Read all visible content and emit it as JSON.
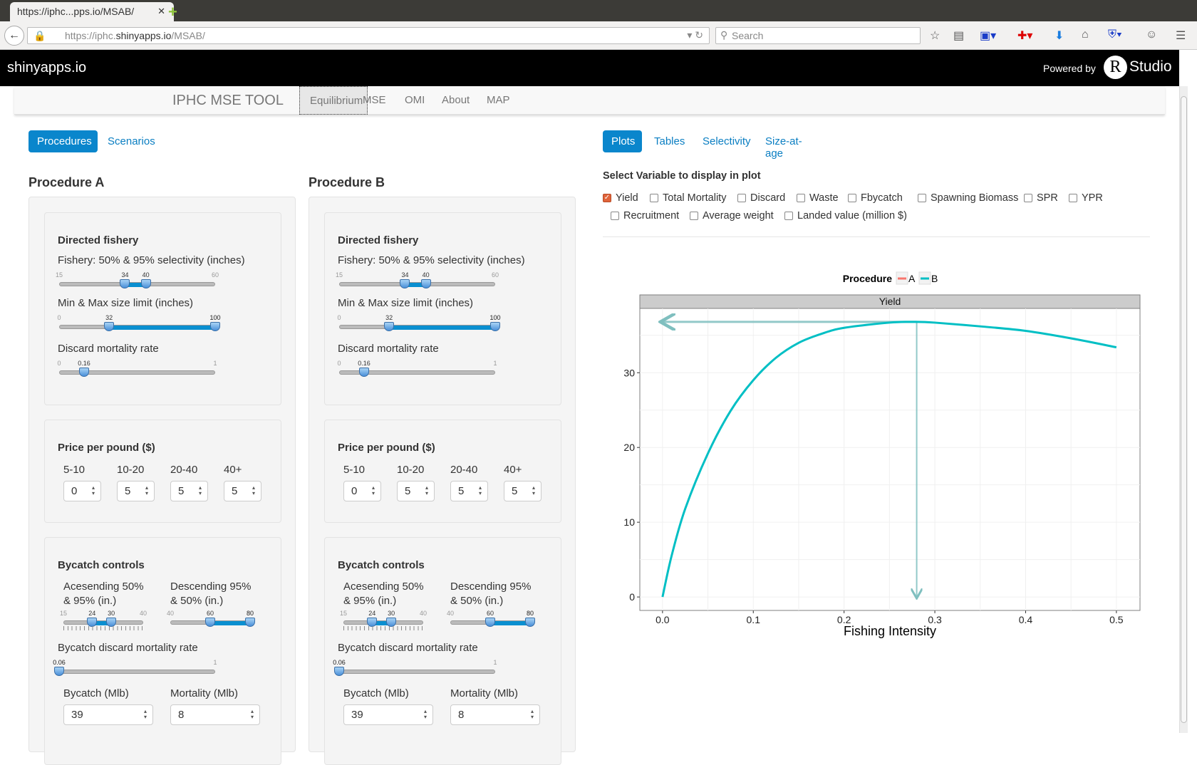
{
  "browser": {
    "tab_title": "https://iphc...pps.io/MSAB/",
    "url_prefix": "https://iphc.",
    "url_domain": "shinyapps.io",
    "url_path": "/MSAB/",
    "search_placeholder": "Search"
  },
  "header": {
    "brand": "shinyapps.io",
    "powered_by": "Powered by",
    "logo_r": "R",
    "logo_studio": "Studio"
  },
  "appnav": {
    "title": "IPHC MSE TOOL",
    "tabs": [
      "Equilibrium",
      "MSE",
      "OMI",
      "About",
      "MAP"
    ],
    "active": "Equilibrium"
  },
  "left_pills": {
    "items": [
      "Procedures",
      "Scenarios"
    ],
    "active": "Procedures"
  },
  "procedures": [
    {
      "title": "Procedure A",
      "directed": {
        "heading": "Directed fishery",
        "selectivity": {
          "label": "Fishery: 50% & 95% selectivity (inches)",
          "min": "15",
          "max": "60",
          "values": [
            34,
            40
          ]
        },
        "size_limit": {
          "label": "Min & Max size limit (inches)",
          "min": "0",
          "max": "100",
          "values": [
            32,
            100
          ]
        },
        "discard": {
          "label": "Discard mortality rate",
          "min": "0",
          "max": "1",
          "values": [
            0.16
          ]
        }
      },
      "price": {
        "heading": "Price per pound ($)",
        "bins": [
          {
            "label": "5-10",
            "value": "0"
          },
          {
            "label": "10-20",
            "value": "5"
          },
          {
            "label": "20-40",
            "value": "5"
          },
          {
            "label": "40+",
            "value": "5"
          }
        ]
      },
      "bycatch": {
        "heading": "Bycatch controls",
        "ascending": {
          "label1": "Acesending 50%",
          "label2": "& 95% (in.)",
          "min": "15",
          "max": "40",
          "values": [
            24,
            30
          ]
        },
        "descending": {
          "label1": "Descending 95%",
          "label2": "& 50% (in.)",
          "min": "40",
          "max": "80",
          "values": [
            60,
            80
          ]
        },
        "discard": {
          "label": "Bycatch discard mortality rate",
          "min": "0.06",
          "max": "1",
          "values": [
            0.06
          ]
        },
        "bycatch_mlb": {
          "label": "Bycatch (Mlb)",
          "value": "39"
        },
        "mortality_mlb": {
          "label": "Mortality (Mlb)",
          "value": "8"
        }
      }
    },
    {
      "title": "Procedure B",
      "directed": {
        "heading": "Directed fishery",
        "selectivity": {
          "label": "Fishery: 50% & 95% selectivity (inches)",
          "min": "15",
          "max": "60",
          "values": [
            34,
            40
          ]
        },
        "size_limit": {
          "label": "Min & Max size limit (inches)",
          "min": "0",
          "max": "100",
          "values": [
            32,
            100
          ]
        },
        "discard": {
          "label": "Discard mortality rate",
          "min": "0",
          "max": "1",
          "values": [
            0.16
          ]
        }
      },
      "price": {
        "heading": "Price per pound ($)",
        "bins": [
          {
            "label": "5-10",
            "value": "0"
          },
          {
            "label": "10-20",
            "value": "5"
          },
          {
            "label": "20-40",
            "value": "5"
          },
          {
            "label": "40+",
            "value": "5"
          }
        ]
      },
      "bycatch": {
        "heading": "Bycatch controls",
        "ascending": {
          "label1": "Acesending 50%",
          "label2": "& 95% (in.)",
          "min": "15",
          "max": "40",
          "values": [
            24,
            30
          ]
        },
        "descending": {
          "label1": "Descending 95%",
          "label2": "& 50% (in.)",
          "min": "40",
          "max": "80",
          "values": [
            60,
            80
          ]
        },
        "discard": {
          "label": "Bycatch discard mortality rate",
          "min": "0.06",
          "max": "1",
          "values": [
            0.06
          ]
        },
        "bycatch_mlb": {
          "label": "Bycatch (Mlb)",
          "value": "39"
        },
        "mortality_mlb": {
          "label": "Mortality (Mlb)",
          "value": "8"
        }
      }
    }
  ],
  "right_pills": {
    "items": [
      "Plots",
      "Tables",
      "Selectivity",
      "Size-at-age"
    ],
    "active": "Plots"
  },
  "variables": {
    "heading": "Select Variable to display in plot",
    "options": [
      {
        "label": "Yield",
        "checked": true
      },
      {
        "label": "Total Mortality",
        "checked": false
      },
      {
        "label": "Discard",
        "checked": false
      },
      {
        "label": "Waste",
        "checked": false
      },
      {
        "label": "Fbycatch",
        "checked": false
      },
      {
        "label": "Spawning Biomass",
        "checked": false
      },
      {
        "label": "SPR",
        "checked": false
      },
      {
        "label": "YPR",
        "checked": false
      },
      {
        "label": "Recruitment",
        "checked": false
      },
      {
        "label": "Average weight",
        "checked": false
      },
      {
        "label": "Landed value (million $)",
        "checked": false
      }
    ]
  },
  "chart_data": {
    "type": "line",
    "facet": "Yield",
    "legend": {
      "title": "Procedure",
      "entries": [
        "A",
        "B"
      ],
      "colors": [
        "#F8766D",
        "#00BFC4"
      ],
      "placement": "top"
    },
    "xlabel": "Fishing Intensity",
    "ylabel": "",
    "xlim": [
      -0.025,
      0.526
    ],
    "ylim": [
      -1.8,
      38.6
    ],
    "xticks": [
      "0.0",
      "0.1",
      "0.2",
      "0.3",
      "0.4",
      "0.5"
    ],
    "yticks": [
      "0",
      "10",
      "20",
      "30"
    ],
    "series": [
      {
        "name": "B",
        "x": [
          0,
          0.01,
          0.025,
          0.05,
          0.075,
          0.1,
          0.125,
          0.15,
          0.175,
          0.2,
          0.25,
          0.28,
          0.3,
          0.35,
          0.4,
          0.45,
          0.5
        ],
        "y": [
          0,
          5.5,
          11.8,
          19.2,
          24.9,
          29,
          32,
          34,
          35.2,
          36,
          36.7,
          36.8,
          36.7,
          36.2,
          35.6,
          34.6,
          33.4
        ]
      }
    ],
    "reference": {
      "x": 0.28,
      "y": 36.8,
      "color": "#7fbfbf"
    }
  }
}
